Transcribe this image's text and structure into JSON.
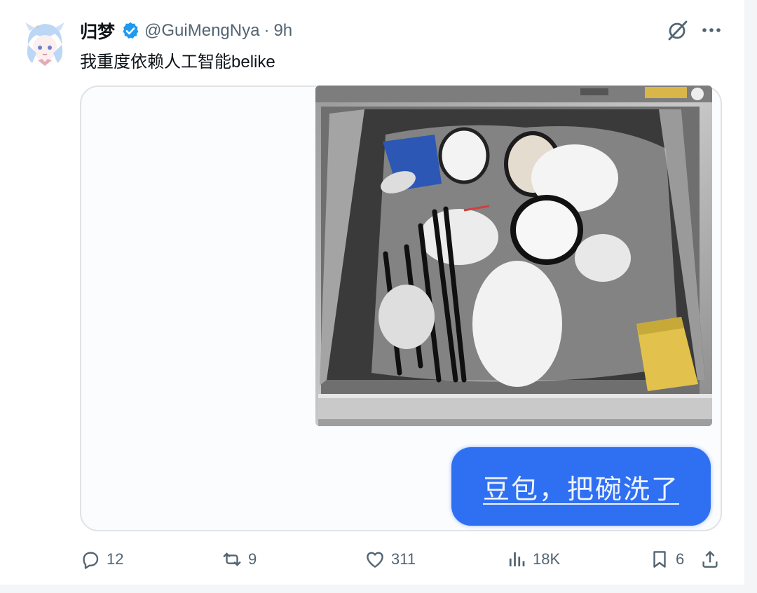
{
  "post": {
    "display_name": "归梦",
    "handle": "@GuiMengNya",
    "separator": "·",
    "time": "9h",
    "text": "我重度依赖人工智能belike",
    "verified": true
  },
  "media": {
    "chat_bubble_text": "豆包，把碗洗了",
    "bubble_color": "#2f6ff2"
  },
  "actions": {
    "replies": "12",
    "reposts": "9",
    "likes": "311",
    "views": "18K",
    "bookmarks": "6"
  },
  "icons": {
    "grok": "grok-icon",
    "more": "more-icon",
    "reply": "reply-icon",
    "repost": "repost-icon",
    "like": "heart-icon",
    "views": "views-icon",
    "bookmark": "bookmark-icon",
    "share": "share-icon"
  },
  "colors": {
    "text_primary": "#0f1419",
    "text_secondary": "#536471",
    "verified_badge": "#1d9bf0"
  }
}
